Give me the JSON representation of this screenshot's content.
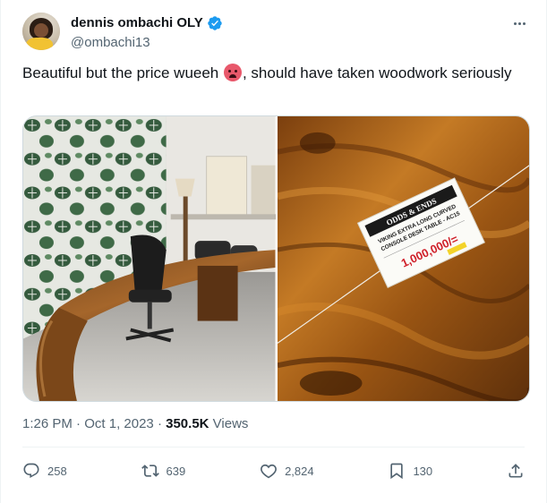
{
  "author": {
    "display_name": "dennis ombachi OLY",
    "handle": "@ombachi13"
  },
  "tweet": {
    "text_before_emoji": "Beautiful but the price wueeh ",
    "emoji": "hot-face-emoji",
    "text_after_emoji": ", should have taken woodwork seriously"
  },
  "media": {
    "tag_brand": "ODDS & ENDS",
    "tag_line1": "VIKING EXTRA LONG CURVED",
    "tag_line2": "CONSOLE DESK TABLE - AC15",
    "tag_price": "1,000,000/="
  },
  "meta": {
    "time": "1:26 PM",
    "separator": " · ",
    "date": "Oct 1, 2023",
    "views_count": "350.5K",
    "views_label": " Views"
  },
  "actions": {
    "replies": "258",
    "retweets": "639",
    "likes": "2,824",
    "bookmarks": "130"
  },
  "colors": {
    "verified": "#1d9bf0",
    "text_primary": "#0f1419",
    "text_secondary": "#536471"
  }
}
